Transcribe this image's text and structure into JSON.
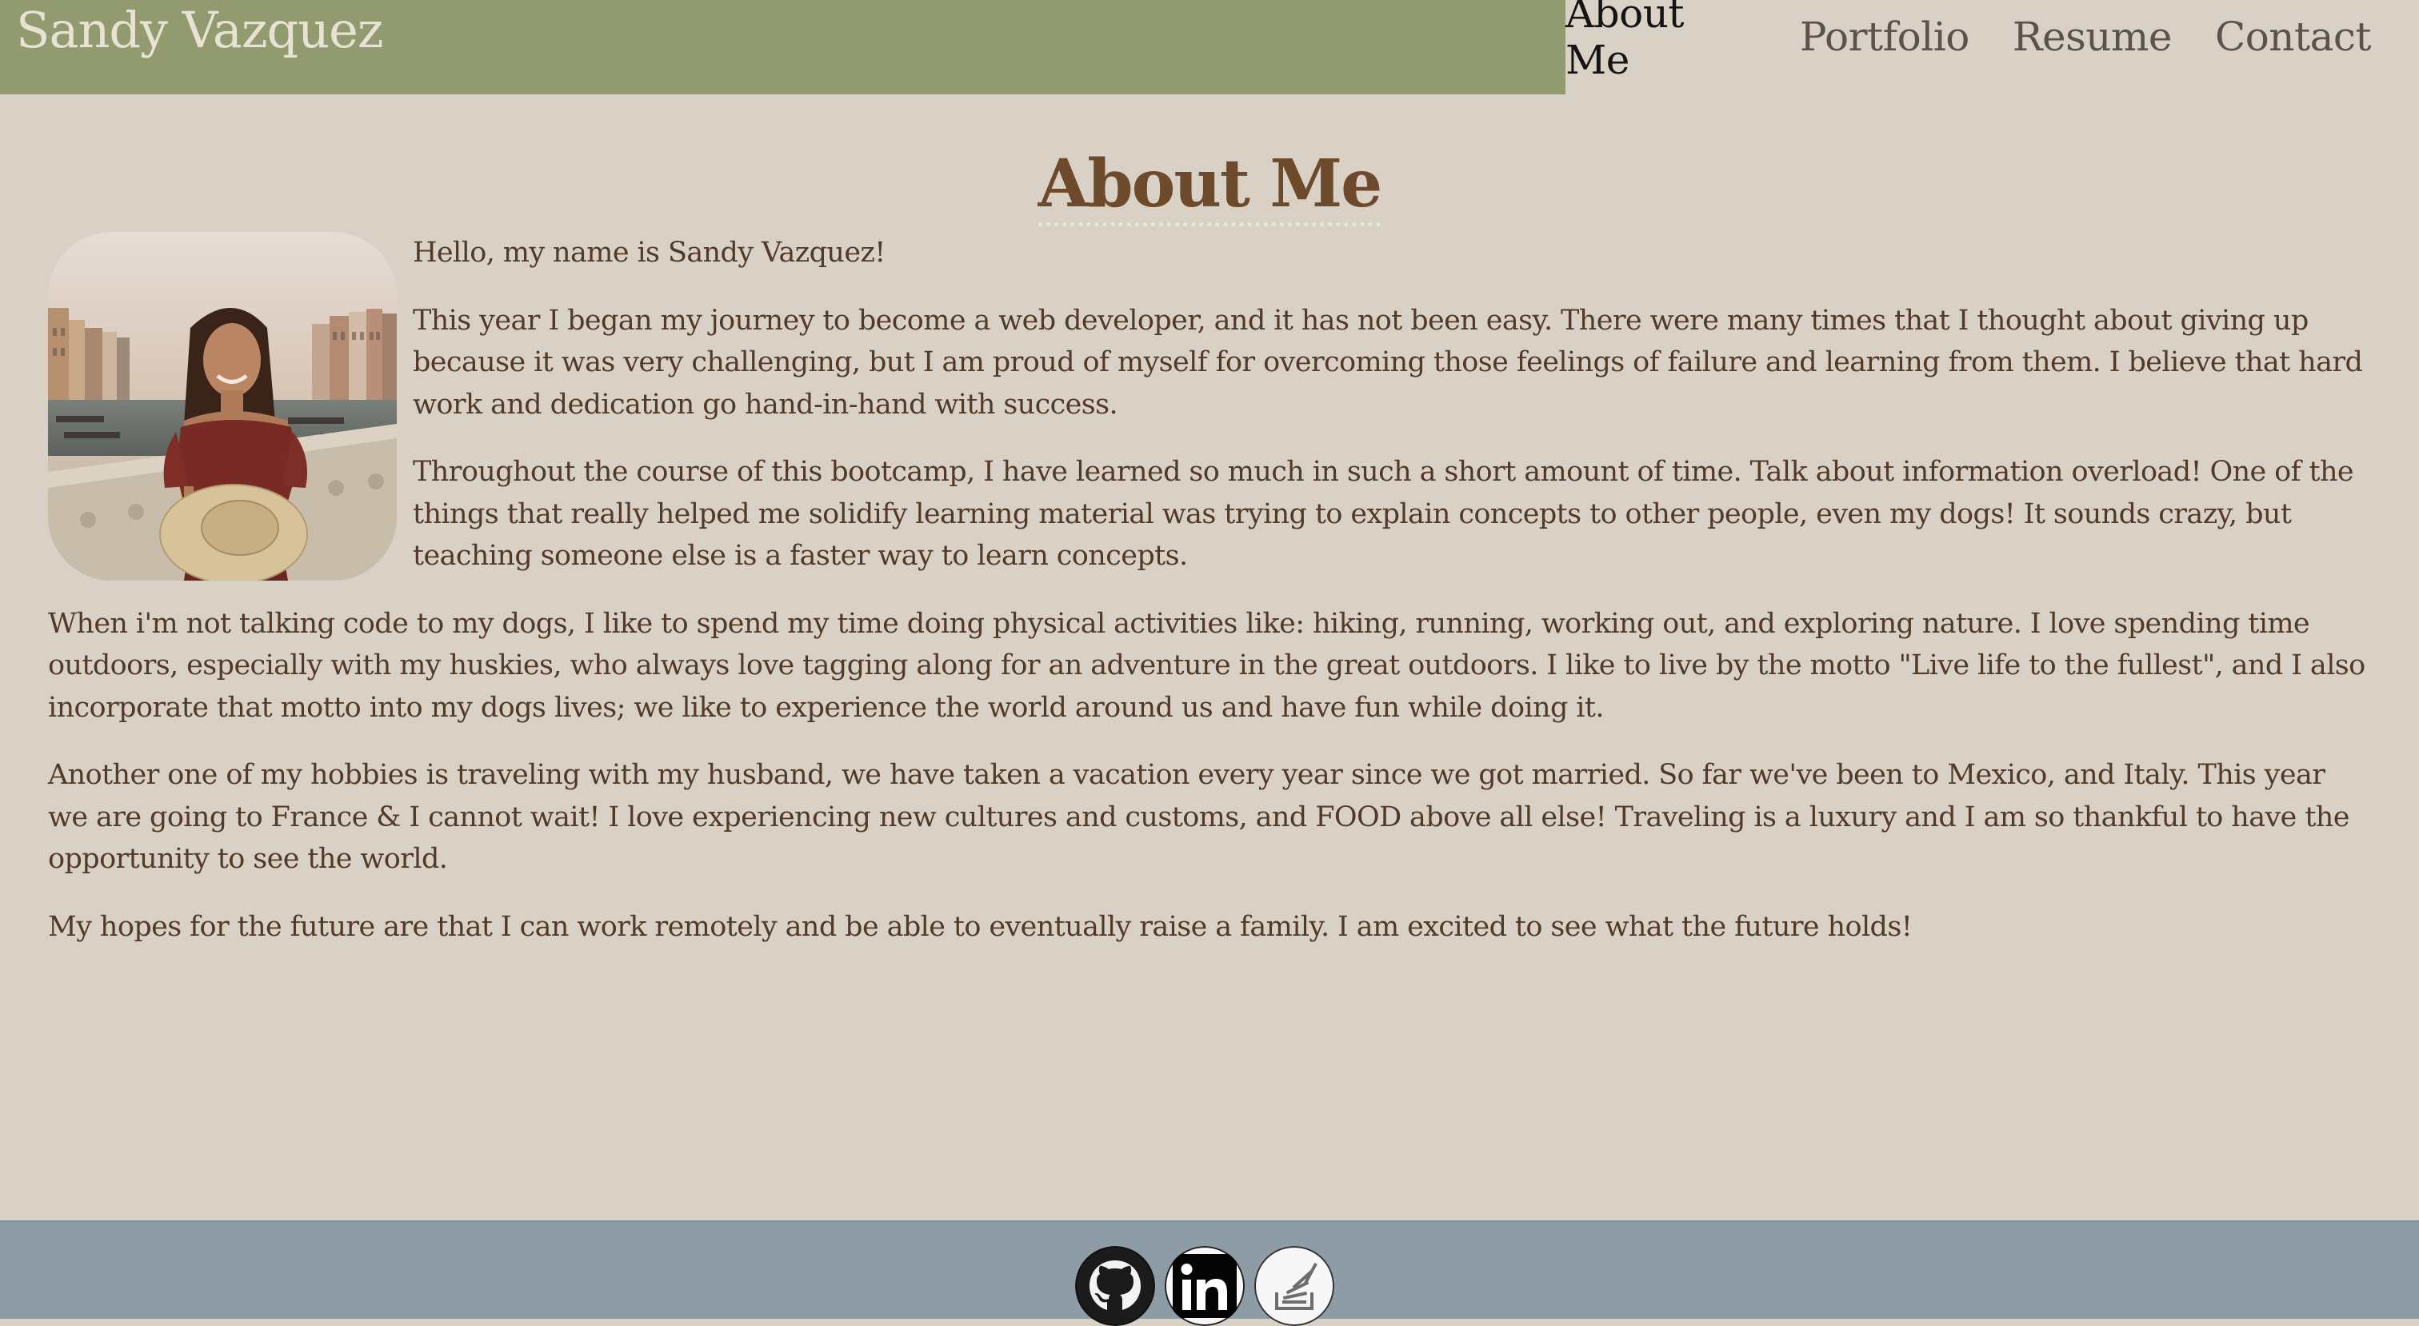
{
  "header": {
    "site_name": "Sandy Vazquez",
    "nav": [
      {
        "label": "About Me",
        "active": true
      },
      {
        "label": "Portfolio",
        "active": false
      },
      {
        "label": "Resume",
        "active": false
      },
      {
        "label": "Contact",
        "active": false
      }
    ]
  },
  "main": {
    "title": "About Me",
    "paragraphs": [
      "Hello, my name is Sandy Vazquez!",
      "This year I began my journey to become a web developer, and it has not been easy. There were many times that I thought about giving up because it was very challenging, but I am proud of myself for overcoming those feelings of failure and learning from them. I believe that hard work and dedication go hand-in-hand with success.",
      "Throughout the course of this bootcamp, I have learned so much in such a short amount of time. Talk about information overload! One of the things that really helped me solidify learning material was trying to explain concepts to other people, even my dogs! It sounds crazy, but teaching someone else is a faster way to learn concepts.",
      "When i'm not talking code to my dogs, I like to spend my time doing physical activities like: hiking, running, working out, and exploring nature. I love spending time outdoors, especially with my huskies, who always love tagging along for an adventure in the great outdoors. I like to live by the motto \"Live life to the fullest\", and I also incorporate that motto into my dogs lives; we like to experience the world around us and have fun while doing it.",
      "Another one of my hobbies is traveling with my husband, we have taken a vacation every year since we got married. So far we've been to Mexico, and Italy. This year we are going to France & I cannot wait! I love experiencing new cultures and customs, and FOOD above all else! Traveling is a luxury and I am so thankful to have the opportunity to see the world.",
      "My hopes for the future are that I can work remotely and be able to eventually raise a family. I am excited to see what the future holds!"
    ]
  },
  "footer": {
    "social_icons": [
      "github-icon",
      "linkedin-icon",
      "stackoverflow-icon"
    ]
  },
  "colors": {
    "page_background": "#d9d1c5",
    "header_green": "#929b6f",
    "title_brown": "#6d4a2b",
    "text_brown": "#523a28",
    "footer_blue_gray": "#8e9da5"
  }
}
